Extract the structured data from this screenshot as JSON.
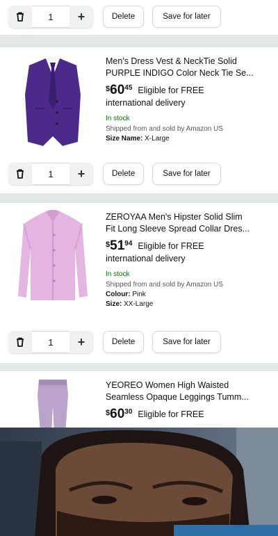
{
  "top_controls": {
    "qty": "1",
    "delete_label": "Delete",
    "save_label": "Save for later"
  },
  "items": [
    {
      "title_lines": [
        "Men's Dress Vest & NeckTie Solid",
        "PURPLE INDIGO Color Neck Tie Se..."
      ],
      "price_symbol": "$",
      "price_whole": "60",
      "price_fraction": "45",
      "eligibility": "Eligible for FREE",
      "eligibility_2": "international delivery",
      "stock": "In stock",
      "shipped": "Shipped from and sold by Amazon US",
      "attrs": [
        {
          "key": "Size Name:",
          "value": " X-Large"
        }
      ],
      "qty": "1",
      "delete_label": "Delete",
      "save_label": "Save for later",
      "image": "purple-vest-with-tie"
    },
    {
      "title_lines": [
        "ZEROYAA Men's Hipster Solid Slim",
        "Fit Long Sleeve Spread Collar Dres..."
      ],
      "price_symbol": "$",
      "price_whole": "51",
      "price_fraction": "94",
      "eligibility": "Eligible for FREE",
      "eligibility_2": "international delivery",
      "stock": "In stock",
      "shipped": "Shipped from and sold by Amazon US",
      "attrs": [
        {
          "key": "Colour:",
          "value": " Pink"
        },
        {
          "key": "Size:",
          "value": " XX-Large"
        }
      ],
      "qty": "1",
      "delete_label": "Delete",
      "save_label": "Save for later",
      "image": "pink-dress-shirt"
    },
    {
      "title_lines": [
        "YEOREO Women High Waisted",
        "Seamless Opaque Leggings Tumm..."
      ],
      "price_symbol": "$",
      "price_whole": "60",
      "price_fraction": "30",
      "eligibility": "Eligible for FREE",
      "image": "lavender-leggings"
    }
  ],
  "icons": {
    "trash": "trash-icon",
    "plus": "plus-icon"
  },
  "colors": {
    "background": "#e3e6e6",
    "stock_green": "#007600",
    "vest": "#4b2a8a",
    "shirt": "#e3b5e0"
  }
}
